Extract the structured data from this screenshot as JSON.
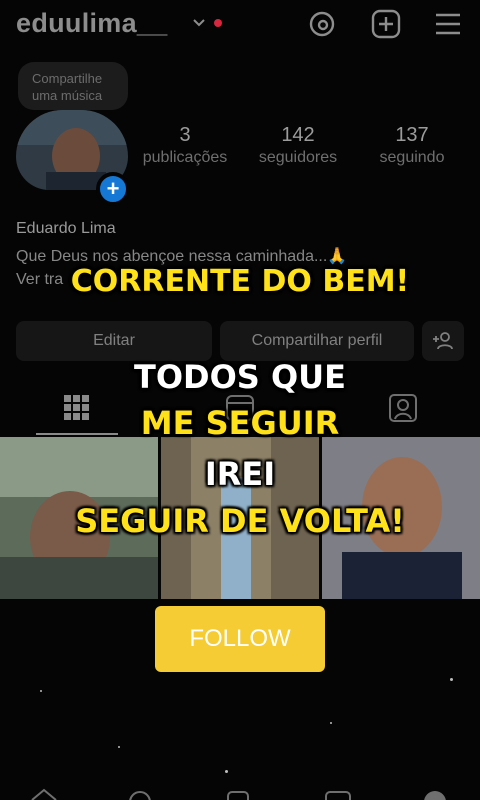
{
  "header": {
    "username": "eduulima__",
    "icons": [
      "chevron-down-icon",
      "threads-icon",
      "add-post-icon",
      "menu-icon"
    ],
    "notification_color": "#d7263d"
  },
  "profile": {
    "note_text": "Compartilhe uma música",
    "full_name": "Eduardo Lima",
    "bio": "Que Deus nos abençoe nessa caminhada...🙏",
    "see_more": "Ver tra"
  },
  "stats": [
    {
      "count": "3",
      "label": "publicações"
    },
    {
      "count": "142",
      "label": "seguidores"
    },
    {
      "count": "137",
      "label": "seguindo"
    }
  ],
  "actions": {
    "edit_label": "Editar",
    "share_label": "Compartilhar perfil",
    "add_person_icon": "add-person-icon"
  },
  "tabs": [
    "grid-icon",
    "reels-icon",
    "tagged-icon"
  ],
  "overlay": {
    "line1": "CORRENTE DO BEM!",
    "line2": "TODOS QUE",
    "line3": "ME SEGUIR",
    "line4": "IREI",
    "line5": "SEGUIR DE VOLTA!",
    "follow_label": "FOLLOW",
    "colors": {
      "yellow": "#ffe11a",
      "button": "#f5cc33"
    }
  }
}
